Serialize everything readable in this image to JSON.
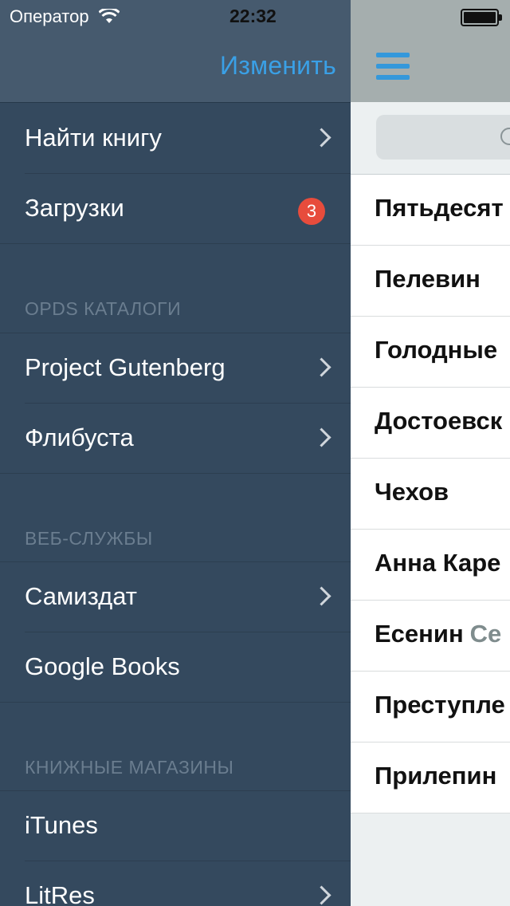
{
  "status_bar": {
    "carrier": "Оператор",
    "time": "22:32"
  },
  "drawer": {
    "edit_label": "Изменить",
    "main_items": [
      {
        "label": "Найти книгу"
      },
      {
        "label": "Загрузки",
        "badge": "3"
      }
    ],
    "sections": [
      {
        "title": "OPDS КАТАЛОГИ",
        "items": [
          "Project Gutenberg",
          "Флибуста"
        ]
      },
      {
        "title": "ВЕБ-СЛУЖБЫ",
        "items": [
          "Самиздат",
          "Google Books"
        ]
      },
      {
        "title": "КНИЖНЫЕ МАГАЗИНЫ",
        "items": [
          "iTunes",
          "LitRes"
        ]
      }
    ]
  },
  "content": {
    "list": [
      {
        "title": "Пятьдесят"
      },
      {
        "title": "Пелевин"
      },
      {
        "title": "Голодные"
      },
      {
        "title": "Достоевск"
      },
      {
        "title": "Чехов"
      },
      {
        "title": "Анна Каре"
      },
      {
        "title": "Есенин",
        "subtitle": "Се"
      },
      {
        "title": "Преступле"
      },
      {
        "title": "Прилепин"
      }
    ]
  },
  "colors": {
    "drawer_bg": "#34495e",
    "accent": "#3aa0e6",
    "badge": "#e74c3c"
  }
}
